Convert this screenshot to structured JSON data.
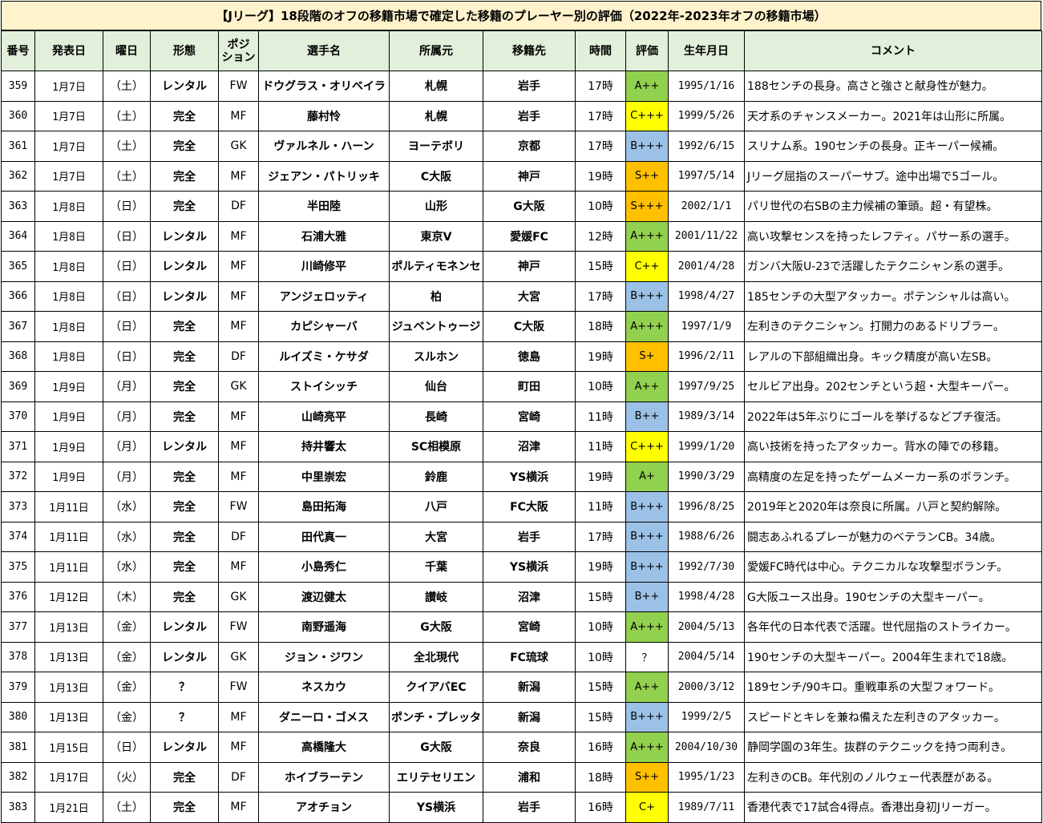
{
  "title": "【Jリーグ】18段階のオフの移籍市場で確定した移籍のプレーヤー別の評価（2022年-2023年オフの移籍市場）",
  "headers": [
    "番号",
    "発表日",
    "曜日",
    "形態",
    "ポジ\nション",
    "選手名",
    "所属元",
    "移籍先",
    "時間",
    "評価",
    "生年月日",
    "コメント"
  ],
  "rating_colors": {
    "A": "#92d050",
    "C": "#ffff00",
    "B": "#9bc2e6",
    "S": "#ffc000",
    "?": "#ffffff"
  },
  "rows": [
    {
      "no": "359",
      "date": "1月7日",
      "day": "（土）",
      "type": "レンタル",
      "pos": "FW",
      "name": "ドウグラス・オリベイラ",
      "from": "札幌",
      "to": "岩手",
      "time": "17時",
      "rating": "A++",
      "birth": "1995/1/16",
      "comment": "188センチの長身。高さと強さと献身性が魅力。"
    },
    {
      "no": "360",
      "date": "1月7日",
      "day": "（土）",
      "type": "完全",
      "pos": "MF",
      "name": "藤村怜",
      "from": "札幌",
      "to": "岩手",
      "time": "17時",
      "rating": "C+++",
      "birth": "1999/5/26",
      "comment": "天才系のチャンスメーカー。2021年は山形に所属。"
    },
    {
      "no": "361",
      "date": "1月7日",
      "day": "（土）",
      "type": "完全",
      "pos": "GK",
      "name": "ヴァルネル・ハーン",
      "from": "ヨーテボリ",
      "to": "京都",
      "time": "17時",
      "rating": "B+++",
      "birth": "1992/6/15",
      "comment": "スリナム系。190センチの長身。正キーパー候補。"
    },
    {
      "no": "362",
      "date": "1月7日",
      "day": "（土）",
      "type": "完全",
      "pos": "MF",
      "name": "ジェアン・パトリッキ",
      "from": "C大阪",
      "to": "神戸",
      "time": "19時",
      "rating": "S++",
      "birth": "1997/5/14",
      "comment": "Jリーグ屈指のスーパーサブ。途中出場で5ゴール。"
    },
    {
      "no": "363",
      "date": "1月8日",
      "day": "（日）",
      "type": "完全",
      "pos": "DF",
      "name": "半田陸",
      "from": "山形",
      "to": "G大阪",
      "time": "10時",
      "rating": "S+++",
      "birth": "2002/1/1",
      "comment": "パリ世代の右SBの主力候補の筆頭。超・有望株。"
    },
    {
      "no": "364",
      "date": "1月8日",
      "day": "（日）",
      "type": "レンタル",
      "pos": "MF",
      "name": "石浦大雅",
      "from": "東京V",
      "to": "愛媛FC",
      "time": "12時",
      "rating": "A+++",
      "birth": "2001/11/22",
      "comment": "高い攻撃センスを持ったレフティ。パサー系の選手。"
    },
    {
      "no": "365",
      "date": "1月8日",
      "day": "（日）",
      "type": "レンタル",
      "pos": "MF",
      "name": "川崎修平",
      "from": "ポルティモネンセ",
      "to": "神戸",
      "time": "15時",
      "rating": "C++",
      "birth": "2001/4/28",
      "comment": "ガンバ大阪U-23で活躍したテクニシャン系の選手。"
    },
    {
      "no": "366",
      "date": "1月8日",
      "day": "（日）",
      "type": "レンタル",
      "pos": "MF",
      "name": "アンジェロッティ",
      "from": "柏",
      "to": "大宮",
      "time": "17時",
      "rating": "B+++",
      "birth": "1998/4/27",
      "comment": "185センチの大型アタッカー。ポテンシャルは高い。"
    },
    {
      "no": "367",
      "date": "1月8日",
      "day": "（日）",
      "type": "完全",
      "pos": "MF",
      "name": "カピシャーバ",
      "from": "ジュベントゥージ",
      "to": "C大阪",
      "time": "18時",
      "rating": "A+++",
      "birth": "1997/1/9",
      "comment": "左利きのテクニシャン。打開力のあるドリブラー。"
    },
    {
      "no": "368",
      "date": "1月8日",
      "day": "（日）",
      "type": "完全",
      "pos": "DF",
      "name": "ルイズミ・ケサダ",
      "from": "スルホン",
      "to": "徳島",
      "time": "19時",
      "rating": "S+",
      "birth": "1996/2/11",
      "comment": "レアルの下部組織出身。キック精度が高い左SB。"
    },
    {
      "no": "369",
      "date": "1月9日",
      "day": "（月）",
      "type": "完全",
      "pos": "GK",
      "name": "ストイシッチ",
      "from": "仙台",
      "to": "町田",
      "time": "10時",
      "rating": "A++",
      "birth": "1997/9/25",
      "comment": "セルビア出身。202センチという超・大型キーパー。"
    },
    {
      "no": "370",
      "date": "1月9日",
      "day": "（月）",
      "type": "完全",
      "pos": "MF",
      "name": "山崎亮平",
      "from": "長崎",
      "to": "宮崎",
      "time": "11時",
      "rating": "B++",
      "birth": "1989/3/14",
      "comment": "2022年は5年ぶりにゴールを挙げるなどプチ復活。"
    },
    {
      "no": "371",
      "date": "1月9日",
      "day": "（月）",
      "type": "レンタル",
      "pos": "MF",
      "name": "持井響太",
      "from": "SC相模原",
      "to": "沼津",
      "time": "11時",
      "rating": "C+++",
      "birth": "1999/1/20",
      "comment": "高い技術を持ったアタッカー。背水の陣での移籍。"
    },
    {
      "no": "372",
      "date": "1月9日",
      "day": "（月）",
      "type": "完全",
      "pos": "MF",
      "name": "中里崇宏",
      "from": "鈴鹿",
      "to": "YS横浜",
      "time": "19時",
      "rating": "A+",
      "birth": "1990/3/29",
      "comment": "高精度の左足を持ったゲームメーカー系のボランチ。"
    },
    {
      "no": "373",
      "date": "1月11日",
      "day": "（水）",
      "type": "完全",
      "pos": "FW",
      "name": "島田拓海",
      "from": "八戸",
      "to": "FC大阪",
      "time": "11時",
      "rating": "B+++",
      "birth": "1996/8/25",
      "comment": "2019年と2020年は奈良に所属。八戸と契約解除。"
    },
    {
      "no": "374",
      "date": "1月11日",
      "day": "（水）",
      "type": "完全",
      "pos": "DF",
      "name": "田代真一",
      "from": "大宮",
      "to": "岩手",
      "time": "17時",
      "rating": "B+++",
      "birth": "1988/6/26",
      "comment": "闘志あふれるプレーが魅力のベテランCB。34歳。"
    },
    {
      "no": "375",
      "date": "1月11日",
      "day": "（水）",
      "type": "完全",
      "pos": "MF",
      "name": "小島秀仁",
      "from": "千葉",
      "to": "YS横浜",
      "time": "19時",
      "rating": "B+++",
      "birth": "1992/7/30",
      "comment": "愛媛FC時代は中心。テクニカルな攻撃型ボランチ。"
    },
    {
      "no": "376",
      "date": "1月12日",
      "day": "（木）",
      "type": "完全",
      "pos": "GK",
      "name": "渡辺健太",
      "from": "讃岐",
      "to": "沼津",
      "time": "15時",
      "rating": "B++",
      "birth": "1998/4/28",
      "comment": "G大阪ユース出身。190センチの大型キーパー。"
    },
    {
      "no": "377",
      "date": "1月13日",
      "day": "（金）",
      "type": "レンタル",
      "pos": "FW",
      "name": "南野遥海",
      "from": "G大阪",
      "to": "宮崎",
      "time": "10時",
      "rating": "A+++",
      "birth": "2004/5/13",
      "comment": "各年代の日本代表で活躍。世代屈指のストライカー。"
    },
    {
      "no": "378",
      "date": "1月13日",
      "day": "（金）",
      "type": "レンタル",
      "pos": "GK",
      "name": "ジョン・ジワン",
      "from": "全北現代",
      "to": "FC琉球",
      "time": "10時",
      "rating": "？",
      "birth": "2004/5/14",
      "comment": "190センチの大型キーパー。2004年生まれで18歳。"
    },
    {
      "no": "379",
      "date": "1月13日",
      "day": "（金）",
      "type": "？",
      "pos": "FW",
      "name": "ネスカウ",
      "from": "クイアバEC",
      "to": "新潟",
      "time": "15時",
      "rating": "A++",
      "birth": "2000/3/12",
      "comment": "189センチ/90キロ。重戦車系の大型フォワード。"
    },
    {
      "no": "380",
      "date": "1月13日",
      "day": "（金）",
      "type": "？",
      "pos": "MF",
      "name": "ダニーロ・ゴメス",
      "from": "ポンチ・プレッタ",
      "to": "新潟",
      "time": "15時",
      "rating": "B+++",
      "birth": "1999/2/5",
      "comment": "スピードとキレを兼ね備えた左利きのアタッカー。"
    },
    {
      "no": "381",
      "date": "1月15日",
      "day": "（日）",
      "type": "レンタル",
      "pos": "MF",
      "name": "高橋隆大",
      "from": "G大阪",
      "to": "奈良",
      "time": "16時",
      "rating": "A+++",
      "birth": "2004/10/30",
      "comment": "静岡学園の3年生。抜群のテクニックを持つ両利き。"
    },
    {
      "no": "382",
      "date": "1月17日",
      "day": "（火）",
      "type": "完全",
      "pos": "DF",
      "name": "ホイブラーテン",
      "from": "エリテセリエン",
      "to": "浦和",
      "time": "18時",
      "rating": "S++",
      "birth": "1995/1/23",
      "comment": "左利きのCB。年代別のノルウェー代表歴がある。"
    },
    {
      "no": "383",
      "date": "1月21日",
      "day": "（土）",
      "type": "完全",
      "pos": "MF",
      "name": "アオチョン",
      "from": "YS横浜",
      "to": "岩手",
      "time": "16時",
      "rating": "C+",
      "birth": "1989/7/11",
      "comment": "香港代表で17試合4得点。香港出身初Jリーガー。"
    }
  ]
}
